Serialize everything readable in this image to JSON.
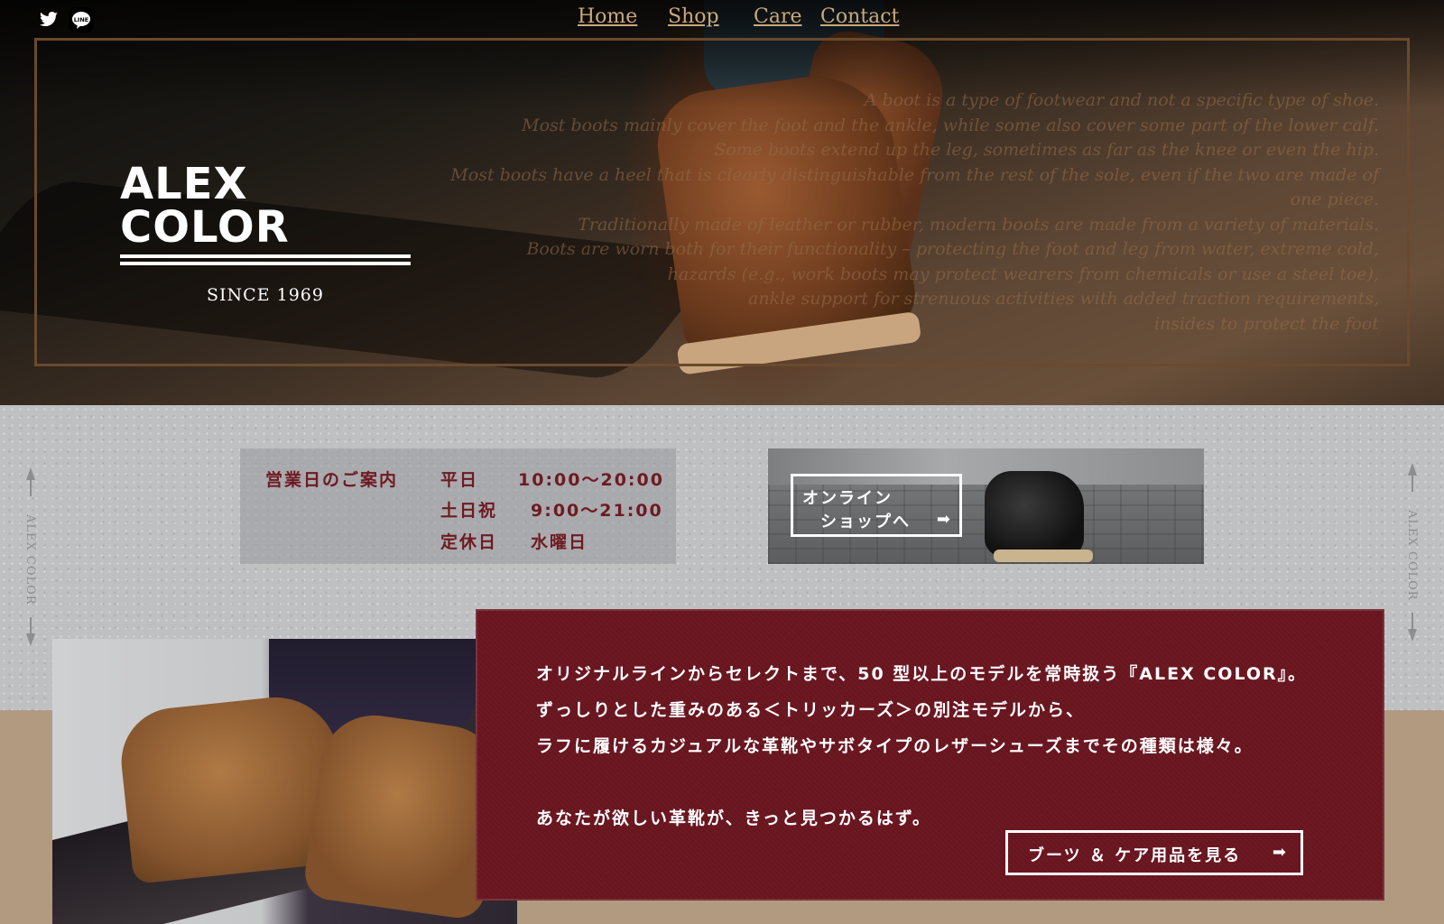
{
  "nav": {
    "home": "Home",
    "shop": "Shop",
    "care": "Care",
    "contact": "Contact"
  },
  "social": {
    "twitter_icon": "twitter-icon",
    "line_icon": "line-icon",
    "line_text": "LINE"
  },
  "hero": {
    "brand": "ALEX COLOR",
    "since": "SINCE 1969",
    "quote": [
      "A boot is a type of footwear and not a specific type of shoe.",
      "Most boots mainly cover the foot and the ankle, while some also cover some part of the lower calf.",
      "Some boots extend up the leg, sometimes as far as the knee or even the hip.",
      "Most boots have a heel that is clearly distinguishable from the rest of the sole, even if the two are made of one piece.",
      "Traditionally made of leather or rubber, modern boots are made from a variety of materials.",
      "Boots are worn both for their functionality – protecting the foot and leg from water, extreme cold,",
      "hazards (e.g., work boots may protect wearers from chemicals or use a steel toe),",
      "ankle support for strenuous activities with added traction requirements,",
      "insides to protect the foot"
    ]
  },
  "side": {
    "left": "ALEX COLOR",
    "right": "ALEX COLOR"
  },
  "hours": {
    "label": "営業日のご案内",
    "rows": [
      {
        "day": "平日",
        "time": "10:00～20:00"
      },
      {
        "day": "土日祝",
        "time": "9:00～21:00"
      },
      {
        "day": "定休日",
        "time": "水曜日"
      }
    ]
  },
  "online": {
    "line1": "オンライン",
    "line2": "ショップへ",
    "arrow": "➡"
  },
  "about": {
    "lines": [
      "オリジナルラインからセレクトまで、50 型以上のモデルを常時扱う『ALEX COLOR』。",
      "ずっしりとした重みのある＜トリッカーズ＞の別注モデルから、",
      "ラフに履けるカジュアルな革靴やサボタイプのレザーシューズまでその種類は様々。",
      "あなたが欲しい革靴が、きっと見つかるはず。"
    ],
    "button": "ブーツ ＆ ケア用品を見る",
    "arrow": "➡"
  },
  "colors": {
    "accent": "#6a1620",
    "nav": "#c9a87a",
    "tan": "#b29a80"
  }
}
